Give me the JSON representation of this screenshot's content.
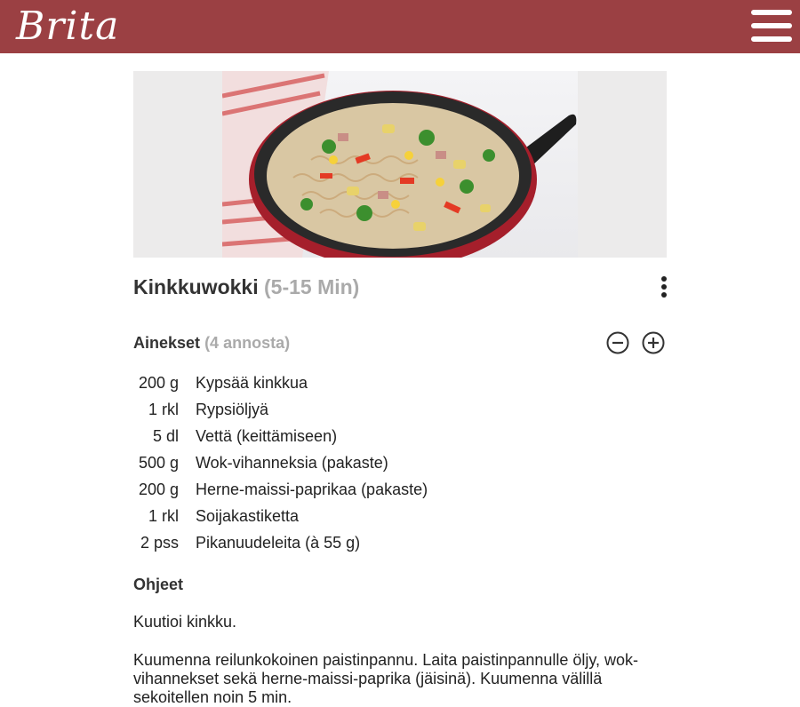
{
  "header": {
    "logo_text": "Brita",
    "bar_color": "#9b4043",
    "menu_icon": "hamburger-menu-icon"
  },
  "hero": {
    "image_subject": "frying pan with noodle stir-fry"
  },
  "recipe": {
    "title": "Kinkkuwokki",
    "time": "(5-15 Min)",
    "more_icon": "more-vertical-icon"
  },
  "ingredients": {
    "heading": "Ainekset",
    "servings": "(4 annosta)",
    "decrease_icon": "minus-circle-icon",
    "increase_icon": "plus-circle-icon",
    "items": [
      {
        "qty": "200 g",
        "name": "Kypsää kinkkua"
      },
      {
        "qty": "1 rkl",
        "name": "Rypsiöljyä"
      },
      {
        "qty": "5 dl",
        "name": "Vettä (keittämiseen)"
      },
      {
        "qty": "500 g",
        "name": "Wok-vihanneksia (pakaste)"
      },
      {
        "qty": "200 g",
        "name": "Herne-maissi-paprikaa (pakaste)"
      },
      {
        "qty": "1 rkl",
        "name": "Soijakastiketta"
      },
      {
        "qty": "2 pss",
        "name": "Pikanuudeleita (à 55 g)"
      }
    ]
  },
  "instructions": {
    "heading": "Ohjeet",
    "steps": [
      "Kuutioi kinkku.",
      "Kuumenna reilunkokoinen paistinpannu. Laita paistinpannulle öljy, wok-vihannekset sekä herne-maissi-paprika (jäisinä). Kuumenna välillä sekoitellen noin 5 min."
    ]
  }
}
